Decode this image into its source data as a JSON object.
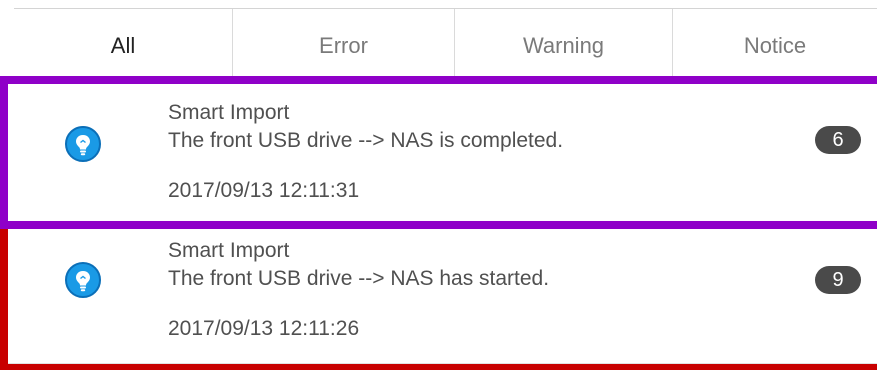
{
  "tabs": [
    {
      "label": "All",
      "active": true
    },
    {
      "label": "Error",
      "active": false
    },
    {
      "label": "Warning",
      "active": false
    },
    {
      "label": "Notice",
      "active": false
    }
  ],
  "notifications": [
    {
      "icon": "lightbulb-icon",
      "title": "Smart Import",
      "message": "The front USB drive --> NAS is completed.",
      "timestamp": "2017/09/13 12:11:31",
      "count": "6",
      "highlight_color": "#8f00c8"
    },
    {
      "icon": "lightbulb-icon",
      "title": "Smart Import",
      "message": "The front USB drive --> NAS has started.",
      "timestamp": "2017/09/13 12:11:26",
      "count": "9",
      "highlight_color": "#c80000"
    }
  ],
  "colors": {
    "icon_blue": "#1a9ae6",
    "badge_bg": "#4a4a4a"
  }
}
